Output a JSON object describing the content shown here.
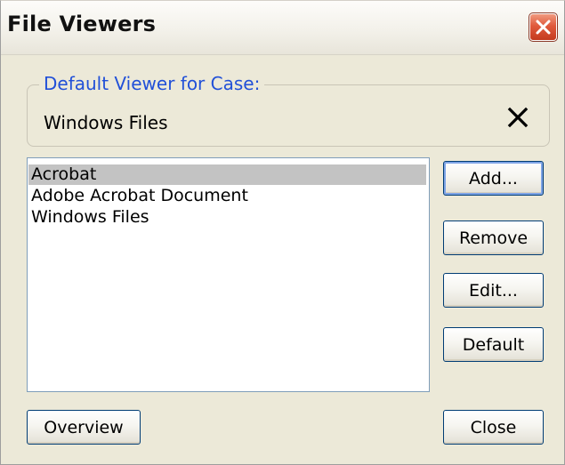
{
  "window": {
    "title": "File Viewers"
  },
  "default_viewer": {
    "legend": "Default Viewer for Case:",
    "value": "Windows Files"
  },
  "viewers_list": {
    "items": [
      {
        "label": "Acrobat",
        "selected": true
      },
      {
        "label": "Adobe Acrobat Document",
        "selected": false
      },
      {
        "label": "Windows Files",
        "selected": false
      }
    ]
  },
  "buttons": {
    "add": "Add...",
    "remove": "Remove",
    "edit": "Edit...",
    "default": "Default",
    "overview": "Overview",
    "close": "Close"
  },
  "icons": {
    "title_close": "close-icon",
    "clear_default": "clear-x-icon"
  },
  "colors": {
    "dialog_bg": "#ece9d8",
    "legend_text": "#2150d8",
    "selection_bg": "#c3c3c3",
    "close_button": "#e05a3c"
  }
}
